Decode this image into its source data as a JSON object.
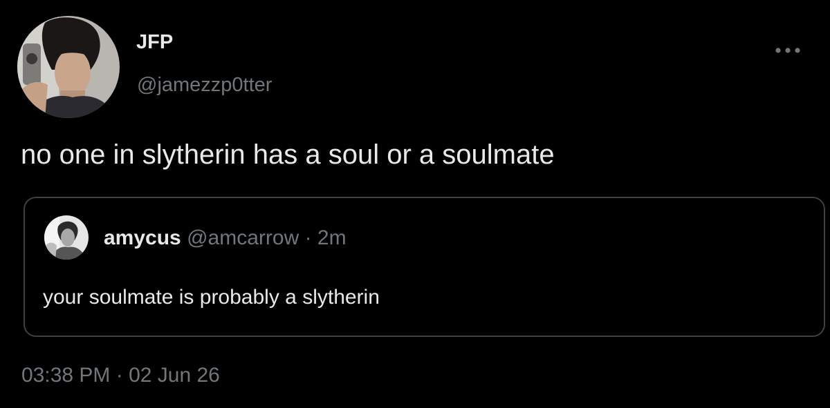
{
  "tweet": {
    "author": {
      "display_name": "JFP",
      "handle": "@jamezzp0tter"
    },
    "text": "no one in slytherin has a soul or a soulmate",
    "timestamp": "03:38 PM · 02 Jun 26",
    "more_icon": "more-horizontal-icon"
  },
  "quoted_tweet": {
    "display_name": "amycus",
    "meta": "@amcarrow · 2m",
    "text": "your soulmate is probably a slytherin"
  },
  "colors": {
    "background": "#000000",
    "primary_text": "#e7e9ea",
    "secondary_text": "#71767b",
    "card_border": "#3e4144"
  }
}
